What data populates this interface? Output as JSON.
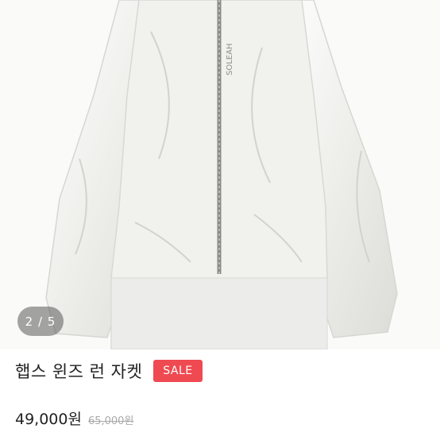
{
  "gallery": {
    "counter": "2 / 5",
    "image_alt": "White zip-up windbreaker jacket",
    "print": "SOLEAH"
  },
  "product": {
    "title": "햅스 윈즈 런 자켓",
    "badge": "SALE",
    "price": "49,000원",
    "original_price": "65,000원"
  },
  "colors": {
    "badge": "#ef4a52",
    "counter_bg": "#5a5a5a"
  }
}
